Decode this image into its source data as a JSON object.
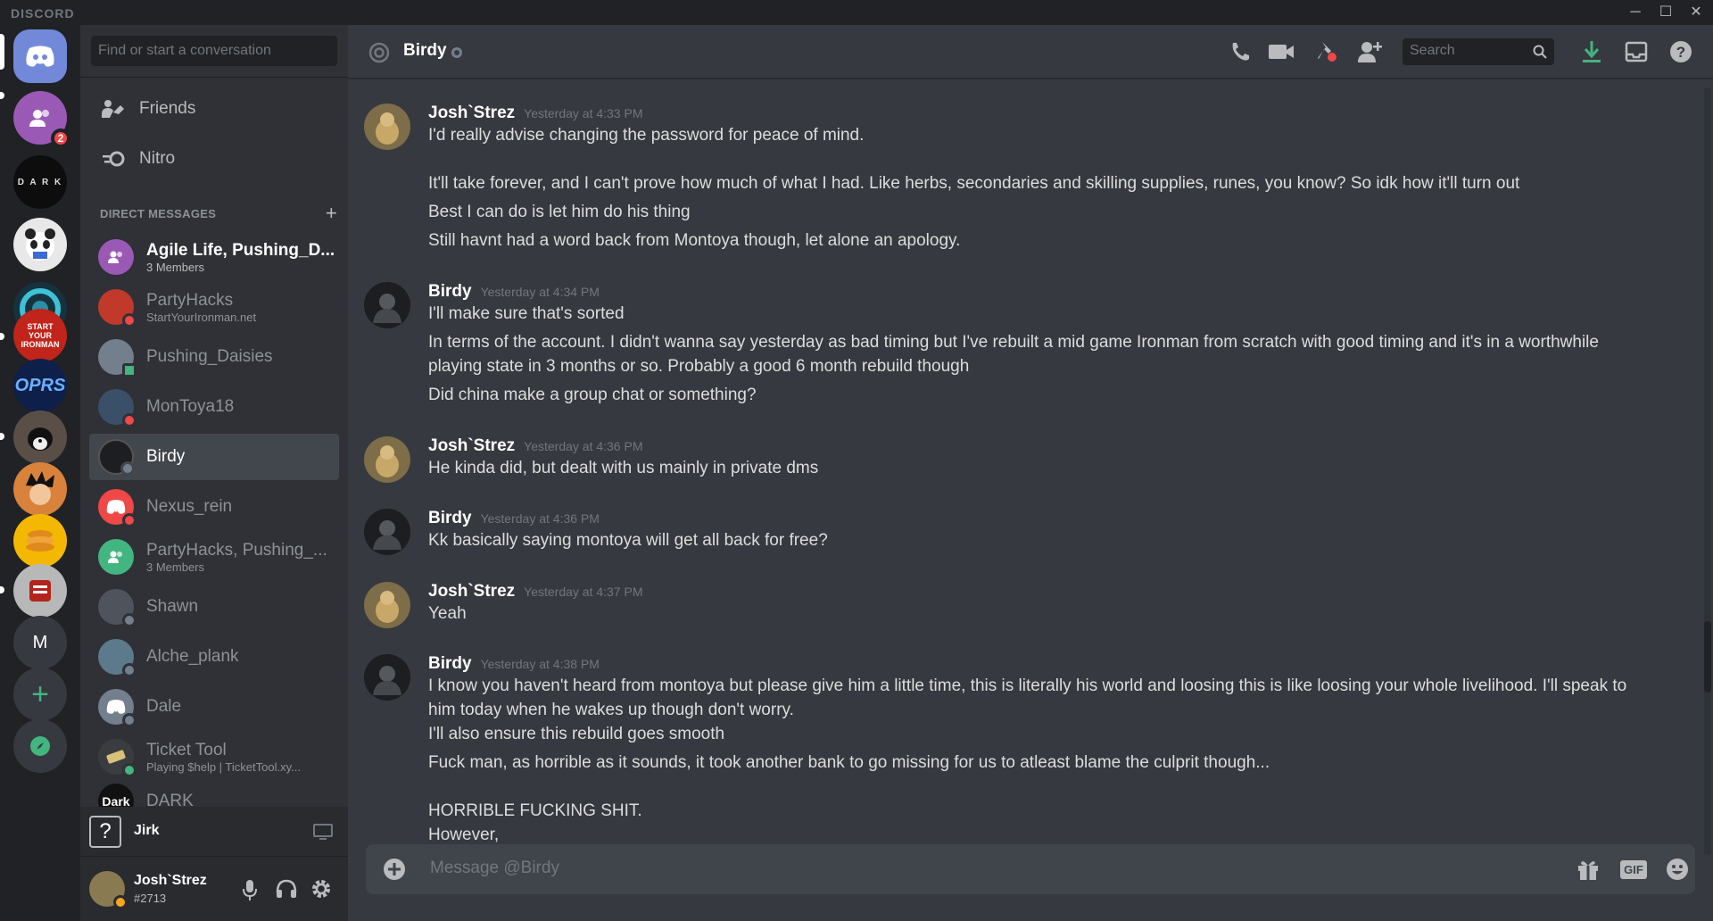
{
  "app": {
    "wordmark": "DISCORD"
  },
  "window_controls": {
    "minimize": "─",
    "maximize": "☐",
    "close": "✕"
  },
  "servers": [
    {
      "name": "Home",
      "icon": "discord-logo-icon"
    },
    {
      "name": "Groups",
      "icon": "group-icon",
      "badge": "2"
    },
    {
      "name": "DARK",
      "label": "D A R K"
    },
    {
      "name": "Panda server",
      "icon": "panda-icon"
    },
    {
      "name": "Swirl server",
      "icon": "swirl-icon"
    },
    {
      "name": "Start Your Ironman",
      "label": "START YOUR IRONMAN"
    },
    {
      "name": "OPRS",
      "label": "OPRS"
    },
    {
      "name": "Dog server",
      "icon": "dog-icon"
    },
    {
      "name": "Anime server",
      "icon": "anime-icon"
    },
    {
      "name": "Pancake server",
      "icon": "pancake-icon"
    },
    {
      "name": "Red server",
      "icon": "red-logo-icon"
    },
    {
      "name": "M",
      "label": "M"
    },
    {
      "name": "Add a Server",
      "icon": "plus-icon"
    },
    {
      "name": "Explore",
      "icon": "compass-icon"
    }
  ],
  "dm_panel": {
    "search_placeholder": "Find or start a conversation",
    "nav": [
      {
        "label": "Friends",
        "icon": "friends-icon"
      },
      {
        "label": "Nitro",
        "icon": "nitro-icon"
      }
    ],
    "header": "DIRECT MESSAGES",
    "add_label": "+",
    "items": [
      {
        "name": "Agile Life, Pushing_D...",
        "sub": "3 Members",
        "color": "#9b59b6",
        "status": "",
        "bold": true
      },
      {
        "name": "PartyHacks",
        "sub": "StartYourIronman.net",
        "color": "#c0392b",
        "status": "dnd"
      },
      {
        "name": "Pushing_Daisies",
        "sub": "",
        "color": "#747f8d",
        "status": "on"
      },
      {
        "name": "MonToya18",
        "sub": "",
        "color": "#34495e",
        "status": "dnd"
      },
      {
        "name": "Birdy",
        "sub": "",
        "color": "#2c2f33",
        "status": "off",
        "active": true
      },
      {
        "name": "Nexus_rein",
        "sub": "",
        "color": "#f04747",
        "status": "dnd"
      },
      {
        "name": "PartyHacks, Pushing_...",
        "sub": "3 Members",
        "color": "#43b581",
        "status": ""
      },
      {
        "name": "Shawn",
        "sub": "",
        "color": "#4f545c",
        "status": "off"
      },
      {
        "name": "Alche_plank",
        "sub": "",
        "color": "#5d7a8c",
        "status": "off"
      },
      {
        "name": "Dale",
        "sub": "",
        "color": "#747f8d",
        "status": "off"
      },
      {
        "name": "Ticket Tool",
        "sub": "Playing $help | TicketTool.xy...",
        "color": "#3a3c40",
        "status": "on"
      },
      {
        "name": "DARK",
        "sub": "",
        "color": "#111",
        "status": "",
        "label": "Dark"
      }
    ]
  },
  "voice": {
    "name": "Jirk",
    "icon": "question-box-icon"
  },
  "user": {
    "name": "Josh`Strez",
    "tag": "#2713"
  },
  "chat": {
    "recipient": "Birdy",
    "search_placeholder": "Search",
    "composer_placeholder": "Message @Birdy",
    "gif_label": "GIF",
    "messages": [
      {
        "author": "Josh`Strez",
        "timestamp": "Yesterday at 4:33 PM",
        "avatar": "josh",
        "lines": [
          "I'd really advise changing the password for peace of mind.",
          "",
          "It'll take forever, and I can't prove how much of what I had. Like herbs, secondaries and skilling supplies, runes, you know? So idk how it'll turn out",
          "Best I can do is let him do his thing",
          "Still havnt had a word back from Montoya though, let alone an apology."
        ]
      },
      {
        "author": "Birdy",
        "timestamp": "Yesterday at 4:34 PM",
        "avatar": "birdy",
        "lines": [
          "I'll make sure that's sorted",
          "In terms of the account. I didn't wanna say yesterday as bad timing but I've rebuilt a mid game Ironman from scratch with good timing and it's in a worthwhile",
          "playing state in 3 months or so. Probably a good 6 month rebuild though",
          "Did china make a group chat or something?"
        ]
      },
      {
        "author": "Josh`Strez",
        "timestamp": "Yesterday at 4:36 PM",
        "avatar": "josh",
        "lines": [
          "He kinda did, but dealt with us mainly in private dms"
        ]
      },
      {
        "author": "Birdy",
        "timestamp": "Yesterday at 4:36 PM",
        "avatar": "birdy",
        "lines": [
          "Kk basically saying montoya will get all back for free?"
        ]
      },
      {
        "author": "Josh`Strez",
        "timestamp": "Yesterday at 4:37 PM",
        "avatar": "josh",
        "lines": [
          "Yeah"
        ]
      },
      {
        "author": "Birdy",
        "timestamp": "Yesterday at 4:38 PM",
        "avatar": "birdy",
        "lines": [
          "I know you haven't heard from montoya but please give him a little time, this is literally his world and loosing this is like loosing your whole livelihood. I'll speak to",
          "him today when he wakes up though don't worry.",
          "I'll also ensure this rebuild goes smooth",
          "Fuck man, as horrible as it sounds, it took another bank to go missing for us to atleast blame the culprit though...",
          "",
          "HORRIBLE FUCKING SHIT.",
          "However,"
        ]
      }
    ]
  }
}
